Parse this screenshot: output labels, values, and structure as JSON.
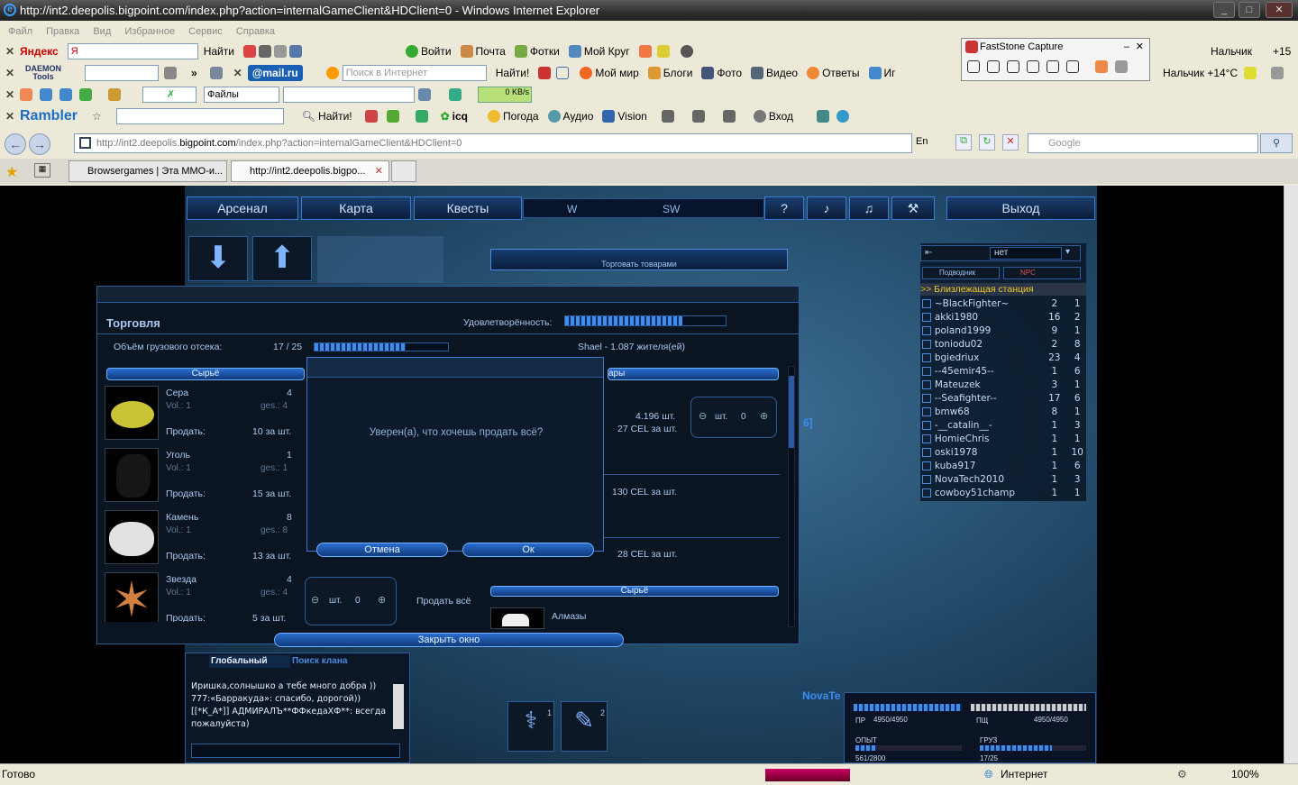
{
  "window": {
    "title": "http://int2.deepolis.bigpoint.com/index.php?action=internalGameClient&HDClient=0 - Windows Internet Explorer"
  },
  "menu": [
    "Файл",
    "Правка",
    "Вид",
    "Избранное",
    "Сервис",
    "Справка"
  ],
  "yandex_bar": {
    "logo": "Яндекс",
    "search_value": "Я",
    "find": "Найти",
    "items": [
      "Войти",
      "Почта",
      "Фотки",
      "Мой Круг"
    ],
    "weather": "Нальчик",
    "temp": "+15"
  },
  "faststone": {
    "title": "FastStone Capture"
  },
  "mailru_bar": {
    "daemon": "DAEMON Tools",
    "mail_logo": "@mail.ru",
    "search_placeholder": "Поиск в Интернет",
    "find": "Найти!",
    "items": [
      "Мой мир",
      "Блоги",
      "Фото",
      "Видео",
      "Ответы",
      "Иг"
    ],
    "weather": "Нальчик +14°C"
  },
  "third_bar": {
    "files": "Файлы",
    "speed": "0 KB/s"
  },
  "rambler_bar": {
    "logo": "Rambler",
    "find": "Найти!",
    "icq": "icq",
    "items": [
      "Погода",
      "Аудио",
      "Vision"
    ],
    "login": "Вход"
  },
  "address": {
    "url_prefix": "http://int2.deepolis.",
    "url_host": "bigpoint.com",
    "url_suffix": "/index.php?action=internalGameClient&HDClient=0",
    "lang": "En",
    "search_placeholder": "Google"
  },
  "tabs": [
    {
      "label": "Browsergames | Эта ММО-и..."
    },
    {
      "label": "http://int2.deepolis.bigpo..."
    }
  ],
  "game": {
    "nav": {
      "arsenal": "Арсенал",
      "map": "Карта",
      "quests": "Квесты",
      "compass_w": "W",
      "compass_sw": "SW",
      "help": "?",
      "exit": "Выход"
    },
    "trade_banner": "Торговать товарами",
    "trade": {
      "title": "Торговля",
      "satisfaction_label": "Удовлетворённость:",
      "cargo_label": "Объём грузового отсека:",
      "cargo_value": "17 / 25",
      "cargo_fill": 0.68,
      "station_info": "Shael - 1.087 жителя(ей)",
      "left_header": "Сырьё",
      "right_header_partial": "ары",
      "items": [
        {
          "name": "Сера",
          "count": "4",
          "vol": "Vol.: 1",
          "ges": "ges.: 4",
          "sell": "Продать:",
          "price": "10 за шт."
        },
        {
          "name": "Уголь",
          "count": "1",
          "vol": "Vol.: 1",
          "ges": "ges.: 1",
          "sell": "Продать:",
          "price": "15 за шт."
        },
        {
          "name": "Камень",
          "count": "8",
          "vol": "Vol.: 1",
          "ges": "ges.: 8",
          "sell": "Продать:",
          "price": "13 за шт."
        },
        {
          "name": "Звезда",
          "count": "4",
          "vol": "Vol.: 1",
          "ges": "ges.: 4",
          "sell": "Продать:",
          "price": "5 за шт."
        }
      ],
      "right_items": {
        "r1_amount": "4.196 шт.",
        "r1_price": "27 CEL за шт.",
        "r2_price": "130 CEL за шт.",
        "r3_price": "28 CEL за шт."
      },
      "qty_label": "шт.",
      "qty_value": "0",
      "sell_all": "Продать всё",
      "bottom_header": "Сырьё",
      "bottom_item": "Алмазы",
      "close": "Закрыть окно"
    },
    "dialog": {
      "message": "Уверен(а), что хочешь продать всё?",
      "cancel": "Отмена",
      "ok": "Ок"
    },
    "players": {
      "filter_value": "нет",
      "tab1": "Подводник",
      "tab2": "NPC",
      "nearest": ">> Близлежащая станция",
      "rows": [
        {
          "name": "~BlackFighter~",
          "a": "2",
          "b": "1"
        },
        {
          "name": "akki1980",
          "a": "16",
          "b": "2"
        },
        {
          "name": "poland1999",
          "a": "9",
          "b": "1"
        },
        {
          "name": "toniodu02",
          "a": "2",
          "b": "8"
        },
        {
          "name": "bgiedriux",
          "a": "23",
          "b": "4"
        },
        {
          "name": "--45emir45--",
          "a": "1",
          "b": "6"
        },
        {
          "name": "Mateuzek",
          "a": "3",
          "b": "1"
        },
        {
          "name": "--Seafighter--",
          "a": "17",
          "b": "6"
        },
        {
          "name": "bmw68",
          "a": "8",
          "b": "1"
        },
        {
          "name": "-__catalin__-",
          "a": "1",
          "b": "3"
        },
        {
          "name": "HomieChris",
          "a": "1",
          "b": "1"
        },
        {
          "name": "oski1978",
          "a": "1",
          "b": "10"
        },
        {
          "name": "kuba917",
          "a": "1",
          "b": "6"
        },
        {
          "name": "NovaTech2010",
          "a": "1",
          "b": "3"
        },
        {
          "name": "cowboy51champ",
          "a": "1",
          "b": "1"
        }
      ]
    },
    "chat": {
      "tab_global": "Глобальный",
      "tab_clan": "Поиск клана",
      "lines": [
        "Иришка,солнышко а тебе много добра ))",
        "777:«Барракуда»: спасибо, дорогой))",
        "[[*К_А*]] АДМИРАЛЪ**ФФкедаХФ**: всегда пожалуйста)"
      ]
    },
    "hud": {
      "player_name": "NovaTe",
      "hp_label": "ПР",
      "hp_value": "4950/4950",
      "shield_label": "ПЩ",
      "shield_value": "4950/4950",
      "exp_label": "ОПЫТ",
      "exp_value": "561/2800",
      "exp_fill": 0.2,
      "cargo_label": "ГРУЗ",
      "cargo_value": "17/25",
      "cargo_fill": 0.68,
      "slot1": "1",
      "slot2": "2",
      "bracket_text": "6]"
    }
  },
  "status": {
    "left": "Готово",
    "zone": "Интернет",
    "zoom": "100%"
  }
}
